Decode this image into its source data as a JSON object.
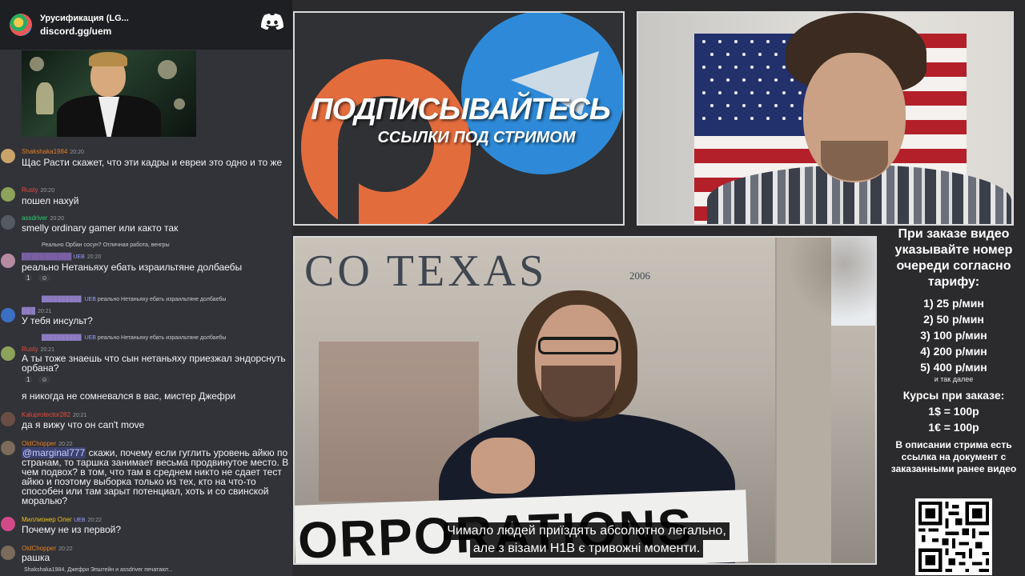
{
  "discord": {
    "server_name": "Урусификация (LG...",
    "invite": "discord.gg/uem",
    "icons": {
      "server": "server-avatar-icon",
      "discord": "discord-logo-icon"
    }
  },
  "chat": {
    "messages": [
      {
        "user": "Shakshaka1984",
        "user_color": "#e67e22",
        "time": "20:20",
        "text": "Щас Расти скажет, что эти кадры и евреи это одно и то же"
      },
      {
        "user": "Rusty",
        "user_color": "#e74c3c",
        "time": "20:20",
        "text": "пошел нахуй"
      },
      {
        "user": "assdriver",
        "user_color": "#2ecc71",
        "time": "20:20",
        "text": "smelly ordinary gamer или както так"
      },
      {
        "reply": "Реально Орбан сосун? Отличная работа, венгры",
        "user": "",
        "badge": "UEB",
        "time": "20:20",
        "text": "реально Нетаньяху ебать израильтяне долбаебы",
        "reactions": [
          "1",
          ""
        ]
      },
      {
        "reply_badge": "UEB",
        "reply": "реально Нетаньяху ебать израильтяне долбаебы",
        "time": "20:21",
        "text": "У тебя инсульт?"
      },
      {
        "reply_badge": "UEB",
        "reply": "реально Нетаньяху ебать израильтяне долбаебы",
        "user": "Rusty",
        "user_color": "#e74c3c",
        "time": "20:21",
        "text": "А ты тоже знаешь что сын нетаньяху приезжал эндорснуть орбана?",
        "reactions": [
          "1",
          ""
        ]
      },
      {
        "text": "я никогда не сомневался в вас, мистер Джефри"
      },
      {
        "user": "Kaluprotector282",
        "user_color": "#e74c3c",
        "time": "20:21",
        "text": "да я вижу что он can't move"
      },
      {
        "user": "OldChopper",
        "user_color": "#e67e22",
        "time": "20:22",
        "mention": "@marginal777",
        "text": " скажи, почему если гуглить уровень айкю по странам, то таршка занимает весьма продвинутое место. В чем подвох? в том, что там в среднем никто не сдает тест айкю и поэтому выборка только из тех, кто на что-то способен или там зарыт потенциал, хоть и со свинской моралью?"
      },
      {
        "user": "Миллионер Олег",
        "user_color": "#f1c40f",
        "badge": "UEB",
        "time": "20:22",
        "text": "Почему не из первой?"
      },
      {
        "user": "OldChopper",
        "user_color": "#e67e22",
        "time": "20:22",
        "text": "рашка"
      }
    ],
    "typing": "Shakshaka1984, Джефри Эпштейн и assdriver печатают..."
  },
  "promo": {
    "title": "ПОДПИСЫВАЙТЕСЬ",
    "subtitle": "ССЫЛКИ ПОД СТРИМОМ",
    "icons": {
      "left": "patreon-logo-icon",
      "right": "telegram-logo-icon"
    }
  },
  "video": {
    "sign_text": "CO TEXAS",
    "sign_year": "2006",
    "banner_text": "ORPORATIONS",
    "subtitle_line1": "Чимало людей приїздять абсолютно легально,",
    "subtitle_line2": "але з візами H1B є тривожні моменти."
  },
  "info": {
    "heading": "При заказе видео указывайте номер очереди согласно тарифу:",
    "tariffs": [
      "1) 25 р/мин",
      "2) 50 р/мин",
      "3) 100 р/мин",
      "4) 200 р/мин",
      "5) 400 р/мин"
    ],
    "more": "и так далее",
    "rates_heading": "Курсы при заказе:",
    "rates": [
      "1$ = 100р",
      "1€ = 100р"
    ],
    "note": "В описании стрима есть ссылка на документ с заказанными ранее видео",
    "qr_icon": "qr-code-icon"
  }
}
